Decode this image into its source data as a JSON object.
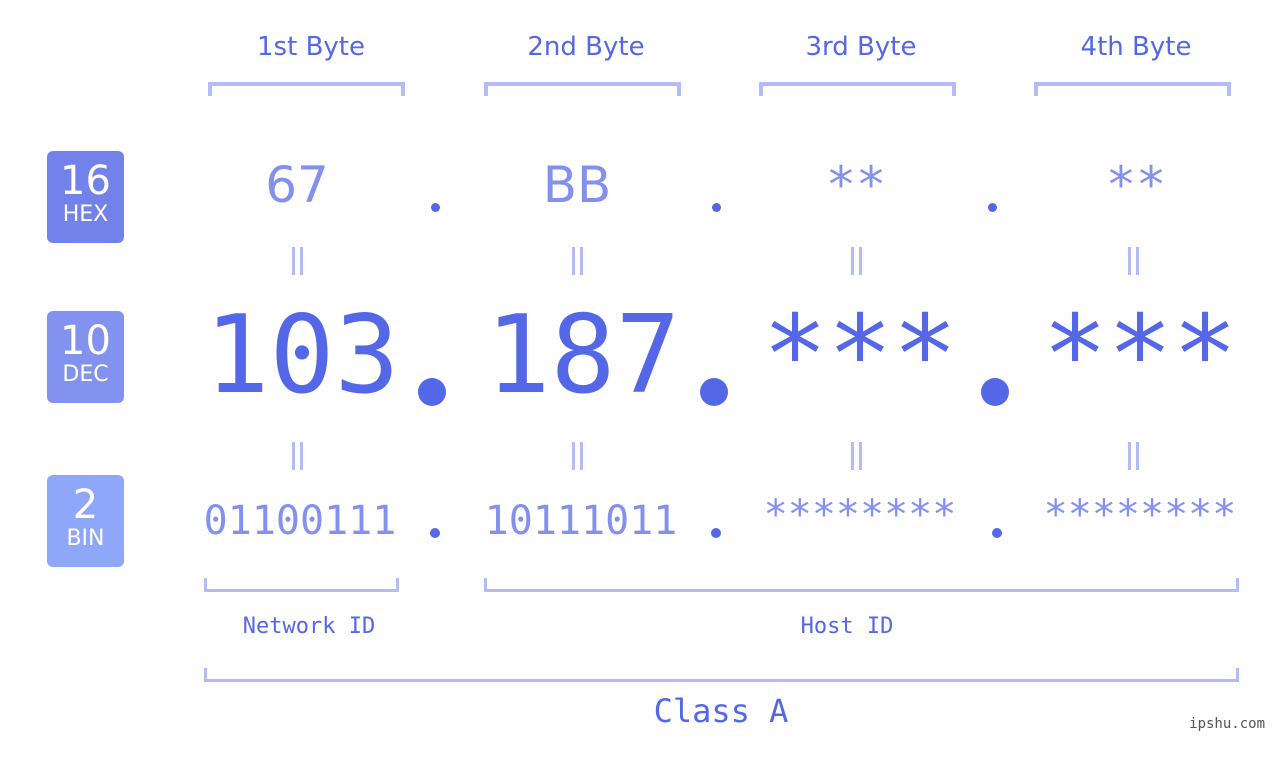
{
  "bytes": {
    "labels": [
      "1st Byte",
      "2nd Byte",
      "3rd Byte",
      "4th Byte"
    ]
  },
  "badges": {
    "hex": {
      "number": "16",
      "label": "HEX",
      "color": "#7382ea"
    },
    "dec": {
      "number": "10",
      "label": "DEC",
      "color": "#8391ef"
    },
    "bin": {
      "number": "2",
      "label": "BIN",
      "color": "#8fa7f8"
    }
  },
  "hex": [
    "67",
    "BB",
    "**",
    "**"
  ],
  "dec": [
    "103",
    "187",
    "***",
    "***"
  ],
  "bin": [
    "01100111",
    "10111011",
    "********",
    "********"
  ],
  "separator": ".",
  "segments": {
    "network": "Network ID",
    "host": "Host ID"
  },
  "ip_class": "Class A",
  "watermark": "ipshu.com",
  "colors": {
    "primary": "#5468e7",
    "secondary": "#8391ed",
    "bracket": "#b3bcf7",
    "background": "#fdfefd"
  }
}
